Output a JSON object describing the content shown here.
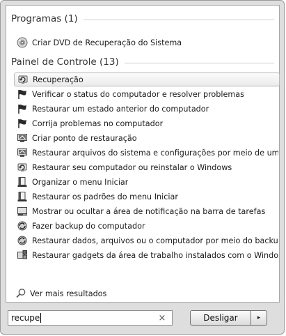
{
  "groups": [
    {
      "title": "Programas (1)"
    },
    {
      "title": "Painel de Controle (13)"
    }
  ],
  "programs": [
    {
      "label": "Criar DVD de Recuperação do Sistema",
      "icon": "dvd-disc-icon"
    }
  ],
  "control_panel": [
    {
      "label": "Recuperação",
      "icon": "recovery-icon",
      "selected": true
    },
    {
      "label": "Verificar o status do computador e resolver problemas",
      "icon": "action-center-flag-icon"
    },
    {
      "label": "Restaurar um estado anterior do computador",
      "icon": "action-center-flag-icon"
    },
    {
      "label": "Corrija problemas no computador",
      "icon": "action-center-flag-icon"
    },
    {
      "label": "Criar ponto de restauração",
      "icon": "system-properties-icon"
    },
    {
      "label": "Restaurar arquivos do sistema e configurações por meio de um...",
      "icon": "system-properties-icon"
    },
    {
      "label": "Restaurar seu computador ou reinstalar o Windows",
      "icon": "recovery-icon"
    },
    {
      "label": "Organizar o menu Iniciar",
      "icon": "taskbar-start-menu-icon"
    },
    {
      "label": "Restaurar os padrões do menu Iniciar",
      "icon": "taskbar-start-menu-icon"
    },
    {
      "label": "Mostrar ou ocultar a área de notificação na barra de tarefas",
      "icon": "notification-area-icon"
    },
    {
      "label": "Fazer backup do computador",
      "icon": "backup-restore-icon"
    },
    {
      "label": "Restaurar dados, arquivos ou o computador por meio do backup",
      "icon": "backup-restore-icon"
    },
    {
      "label": "Restaurar gadgets da área de trabalho instalados com o Windows",
      "icon": "desktop-gadgets-icon"
    }
  ],
  "more_results": {
    "label": "Ver mais resultados",
    "icon": "search-icon"
  },
  "search": {
    "value": "recupe",
    "clear_glyph": "×"
  },
  "shutdown": {
    "label": "Desligar",
    "arrow_glyph": "▸"
  }
}
